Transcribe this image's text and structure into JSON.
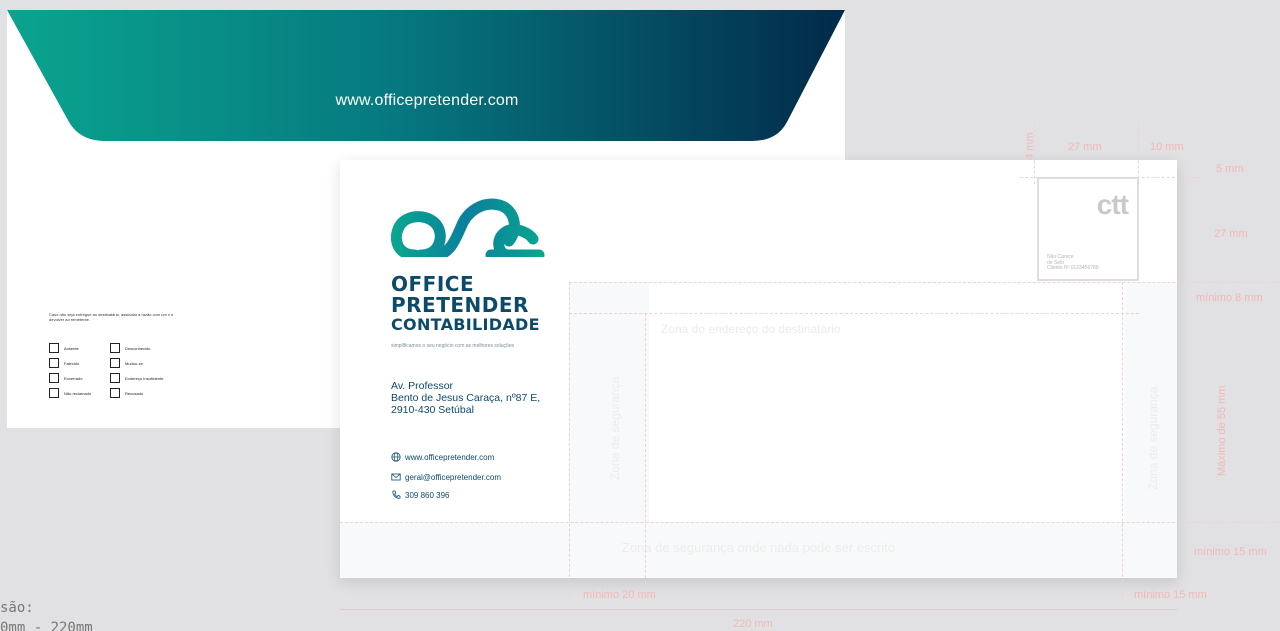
{
  "back_envelope": {
    "flap_url": "www.officepretender.com",
    "return_note": "Caso não seja entregue ao destinatário, assinalar a razão com um x e devolver ao remetente.",
    "checkboxes": [
      "Ausente",
      "Desconhecido",
      "Falecido",
      "Mudou-se",
      "Encerrado",
      "Endereço Insuficiente",
      "Não reclamado",
      "Recusado"
    ]
  },
  "front_envelope": {
    "brand_line1": "OFFICE",
    "brand_line2": "PRETENDER",
    "brand_line3": "CONTABILIDADE",
    "tagline": "simplificamos o seu negócio com as melhores soluções",
    "address_line1": "Av. Professor",
    "address_line2": "Bento de Jesus Caraça, nº87 E,",
    "address_line3": "2910-430 Setúbal",
    "website": "www.officepretender.com",
    "email": "geral@officepretender.com",
    "phone": "309 860 396",
    "stamp_logo": "ctt",
    "stamp_line1": "Não Carece",
    "stamp_line2": "de Selo",
    "stamp_line3": "Cliente Nº 0123456789",
    "zone_destination": "Zona do endereço do destinatário",
    "zone_safety": "Zona de segurança",
    "zone_bottom": "Zona de segurança onde nada pode ser escrito"
  },
  "dimensions": {
    "d4mm": "4 mm",
    "d27mm_top": "27 mm",
    "d10mm": "10 mm",
    "d5mm": "5 mm",
    "d27mm_side": "27 mm",
    "min8": "mínimo 8 mm",
    "max55": "Máximo de 55 mm",
    "min15_right": "mínimo 15 mm",
    "min20": "mínimo 20 mm",
    "min15_bottom": "mínimo 15 mm",
    "width220": "220 mm"
  },
  "info": {
    "line1": "são:",
    "line2": "0mm - 220mm"
  },
  "colors": {
    "gradient_start": "#0aa48f",
    "gradient_end": "#022a4a",
    "brand_dark": "#0c4a6a"
  }
}
